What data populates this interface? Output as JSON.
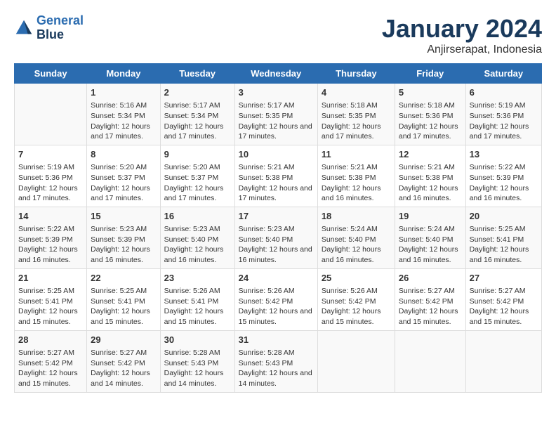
{
  "header": {
    "logo_line1": "General",
    "logo_line2": "Blue",
    "month": "January 2024",
    "location": "Anjirserapat, Indonesia"
  },
  "days_of_week": [
    "Sunday",
    "Monday",
    "Tuesday",
    "Wednesday",
    "Thursday",
    "Friday",
    "Saturday"
  ],
  "weeks": [
    [
      {
        "day": "",
        "info": ""
      },
      {
        "day": "1",
        "info": "Sunrise: 5:16 AM\nSunset: 5:34 PM\nDaylight: 12 hours and 17 minutes."
      },
      {
        "day": "2",
        "info": "Sunrise: 5:17 AM\nSunset: 5:34 PM\nDaylight: 12 hours and 17 minutes."
      },
      {
        "day": "3",
        "info": "Sunrise: 5:17 AM\nSunset: 5:35 PM\nDaylight: 12 hours and 17 minutes."
      },
      {
        "day": "4",
        "info": "Sunrise: 5:18 AM\nSunset: 5:35 PM\nDaylight: 12 hours and 17 minutes."
      },
      {
        "day": "5",
        "info": "Sunrise: 5:18 AM\nSunset: 5:36 PM\nDaylight: 12 hours and 17 minutes."
      },
      {
        "day": "6",
        "info": "Sunrise: 5:19 AM\nSunset: 5:36 PM\nDaylight: 12 hours and 17 minutes."
      }
    ],
    [
      {
        "day": "7",
        "info": "Sunrise: 5:19 AM\nSunset: 5:36 PM\nDaylight: 12 hours and 17 minutes."
      },
      {
        "day": "8",
        "info": "Sunrise: 5:20 AM\nSunset: 5:37 PM\nDaylight: 12 hours and 17 minutes."
      },
      {
        "day": "9",
        "info": "Sunrise: 5:20 AM\nSunset: 5:37 PM\nDaylight: 12 hours and 17 minutes."
      },
      {
        "day": "10",
        "info": "Sunrise: 5:21 AM\nSunset: 5:38 PM\nDaylight: 12 hours and 17 minutes."
      },
      {
        "day": "11",
        "info": "Sunrise: 5:21 AM\nSunset: 5:38 PM\nDaylight: 12 hours and 16 minutes."
      },
      {
        "day": "12",
        "info": "Sunrise: 5:21 AM\nSunset: 5:38 PM\nDaylight: 12 hours and 16 minutes."
      },
      {
        "day": "13",
        "info": "Sunrise: 5:22 AM\nSunset: 5:39 PM\nDaylight: 12 hours and 16 minutes."
      }
    ],
    [
      {
        "day": "14",
        "info": "Sunrise: 5:22 AM\nSunset: 5:39 PM\nDaylight: 12 hours and 16 minutes."
      },
      {
        "day": "15",
        "info": "Sunrise: 5:23 AM\nSunset: 5:39 PM\nDaylight: 12 hours and 16 minutes."
      },
      {
        "day": "16",
        "info": "Sunrise: 5:23 AM\nSunset: 5:40 PM\nDaylight: 12 hours and 16 minutes."
      },
      {
        "day": "17",
        "info": "Sunrise: 5:23 AM\nSunset: 5:40 PM\nDaylight: 12 hours and 16 minutes."
      },
      {
        "day": "18",
        "info": "Sunrise: 5:24 AM\nSunset: 5:40 PM\nDaylight: 12 hours and 16 minutes."
      },
      {
        "day": "19",
        "info": "Sunrise: 5:24 AM\nSunset: 5:40 PM\nDaylight: 12 hours and 16 minutes."
      },
      {
        "day": "20",
        "info": "Sunrise: 5:25 AM\nSunset: 5:41 PM\nDaylight: 12 hours and 16 minutes."
      }
    ],
    [
      {
        "day": "21",
        "info": "Sunrise: 5:25 AM\nSunset: 5:41 PM\nDaylight: 12 hours and 15 minutes."
      },
      {
        "day": "22",
        "info": "Sunrise: 5:25 AM\nSunset: 5:41 PM\nDaylight: 12 hours and 15 minutes."
      },
      {
        "day": "23",
        "info": "Sunrise: 5:26 AM\nSunset: 5:41 PM\nDaylight: 12 hours and 15 minutes."
      },
      {
        "day": "24",
        "info": "Sunrise: 5:26 AM\nSunset: 5:42 PM\nDaylight: 12 hours and 15 minutes."
      },
      {
        "day": "25",
        "info": "Sunrise: 5:26 AM\nSunset: 5:42 PM\nDaylight: 12 hours and 15 minutes."
      },
      {
        "day": "26",
        "info": "Sunrise: 5:27 AM\nSunset: 5:42 PM\nDaylight: 12 hours and 15 minutes."
      },
      {
        "day": "27",
        "info": "Sunrise: 5:27 AM\nSunset: 5:42 PM\nDaylight: 12 hours and 15 minutes."
      }
    ],
    [
      {
        "day": "28",
        "info": "Sunrise: 5:27 AM\nSunset: 5:42 PM\nDaylight: 12 hours and 15 minutes."
      },
      {
        "day": "29",
        "info": "Sunrise: 5:27 AM\nSunset: 5:42 PM\nDaylight: 12 hours and 14 minutes."
      },
      {
        "day": "30",
        "info": "Sunrise: 5:28 AM\nSunset: 5:43 PM\nDaylight: 12 hours and 14 minutes."
      },
      {
        "day": "31",
        "info": "Sunrise: 5:28 AM\nSunset: 5:43 PM\nDaylight: 12 hours and 14 minutes."
      },
      {
        "day": "",
        "info": ""
      },
      {
        "day": "",
        "info": ""
      },
      {
        "day": "",
        "info": ""
      }
    ]
  ]
}
